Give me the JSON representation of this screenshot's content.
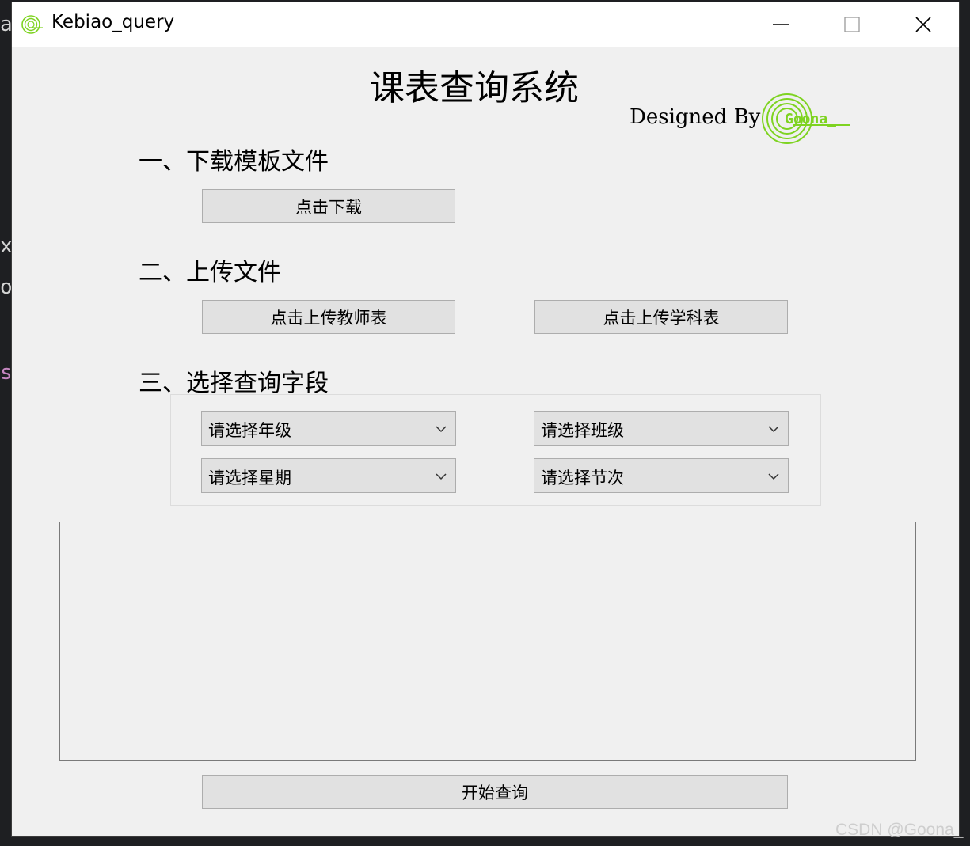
{
  "window": {
    "title": "Kebiao_query"
  },
  "header": {
    "title": "课表查询系统",
    "designed_by": "Designed By",
    "logo_text": "Goona_"
  },
  "section1": {
    "title": "一、下载模板文件",
    "download_button": "点击下载"
  },
  "section2": {
    "title": "二、上传文件",
    "upload_teacher_button": "点击上传教师表",
    "upload_subject_button": "点击上传学科表"
  },
  "section3": {
    "title": "三、选择查询字段",
    "grade_select": "请选择年级",
    "class_select": "请选择班级",
    "weekday_select": "请选择星期",
    "period_select": "请选择节次"
  },
  "query_button": "开始查询",
  "watermark": "CSDN @Goona_",
  "colors": {
    "window_bg": "#f0f0f0",
    "button_bg": "#e1e1e1",
    "logo_green": "#7ed321"
  }
}
